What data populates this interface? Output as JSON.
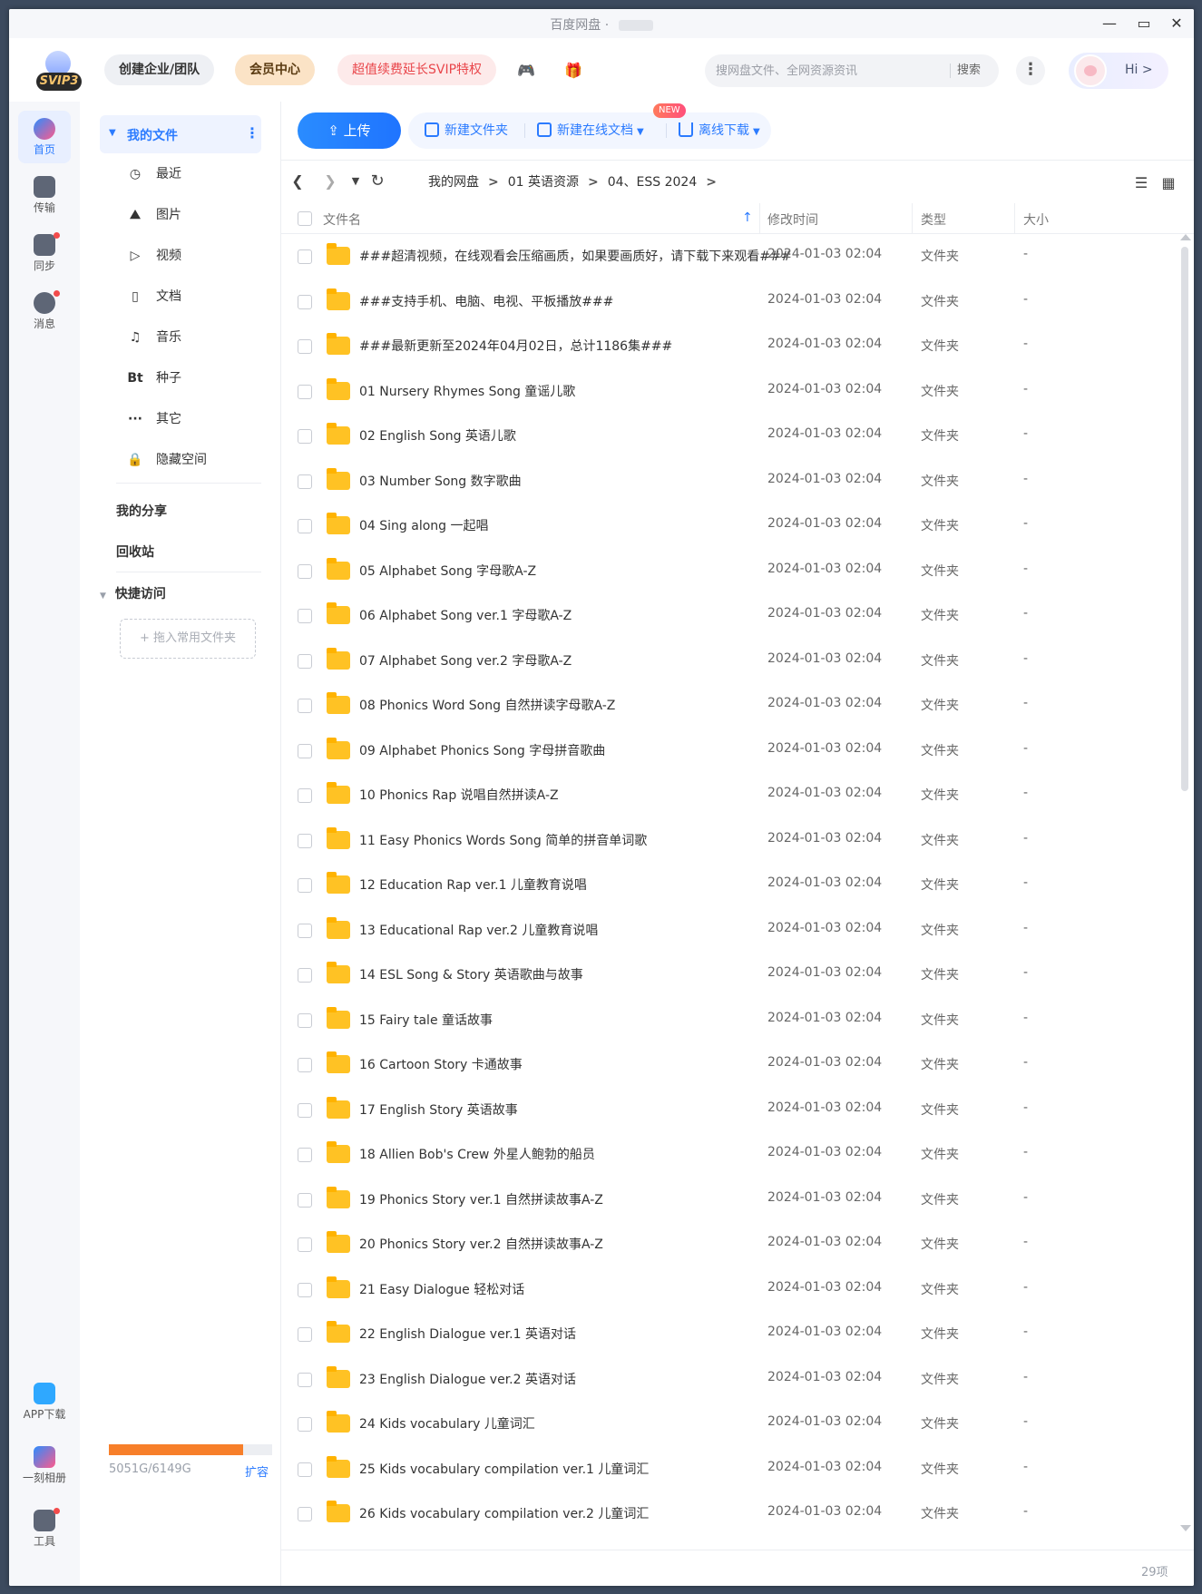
{
  "window": {
    "title": "百度网盘"
  },
  "header": {
    "logo_badge": "SVIP3",
    "team_label": "创建企业/团队",
    "vip_label": "会员中心",
    "promo_label": "超值续费延长SVIP特权",
    "search_placeholder": "搜网盘文件、全网资源资讯",
    "search_button": "搜索",
    "greeting": "Hi >"
  },
  "rail": {
    "items": [
      {
        "label": "首页"
      },
      {
        "label": "传输"
      },
      {
        "label": "同步"
      },
      {
        "label": "消息"
      },
      {
        "label": "APP下载"
      },
      {
        "label": "一刻相册"
      },
      {
        "label": "工具"
      }
    ]
  },
  "sidebar": {
    "my_files": "我的文件",
    "items": [
      {
        "icon": "◷",
        "label": "最近"
      },
      {
        "icon": "⛰",
        "label": "图片"
      },
      {
        "icon": "▷",
        "label": "视频"
      },
      {
        "icon": "▯",
        "label": "文档"
      },
      {
        "icon": "♫",
        "label": "音乐"
      },
      {
        "icon": "Bt",
        "label": "种子"
      },
      {
        "icon": "···",
        "label": "其它"
      },
      {
        "icon": "🔒",
        "label": "隐藏空间"
      }
    ],
    "my_share": "我的分享",
    "recycle": "回收站",
    "quick_access": "快捷访问",
    "drop_hint": "+ 拖入常用文件夹",
    "quota": "5051G/6149G",
    "quota_used_fraction": 0.821,
    "expand": "扩容"
  },
  "toolbar": {
    "upload": "上传",
    "new_folder": "新建文件夹",
    "new_doc": "新建在线文档",
    "new_badge": "NEW",
    "offline": "离线下载"
  },
  "breadcrumb": [
    "我的网盘",
    "01 英语资源",
    "04、ESS 2024"
  ],
  "table": {
    "headers": {
      "name": "文件名",
      "mtime": "修改时间",
      "type": "类型",
      "size": "大小"
    },
    "rows": [
      {
        "name": "###超清视频，在线观看会压缩画质，如果要画质好，请下载下来观看###",
        "mtime": "2024-01-03 02:04",
        "type": "文件夹",
        "size": "-"
      },
      {
        "name": "###支持手机、电脑、电视、平板播放###",
        "mtime": "2024-01-03 02:04",
        "type": "文件夹",
        "size": "-"
      },
      {
        "name": "###最新更新至2024年04月02日，总计1186集###",
        "mtime": "2024-01-03 02:04",
        "type": "文件夹",
        "size": "-"
      },
      {
        "name": "01 Nursery Rhymes Song 童谣儿歌",
        "mtime": "2024-01-03 02:04",
        "type": "文件夹",
        "size": "-"
      },
      {
        "name": "02 English Song 英语儿歌",
        "mtime": "2024-01-03 02:04",
        "type": "文件夹",
        "size": "-"
      },
      {
        "name": "03 Number Song 数字歌曲",
        "mtime": "2024-01-03 02:04",
        "type": "文件夹",
        "size": "-"
      },
      {
        "name": "04 Sing along 一起唱",
        "mtime": "2024-01-03 02:04",
        "type": "文件夹",
        "size": "-"
      },
      {
        "name": "05 Alphabet Song 字母歌A-Z",
        "mtime": "2024-01-03 02:04",
        "type": "文件夹",
        "size": "-"
      },
      {
        "name": "06 Alphabet Song ver.1 字母歌A-Z",
        "mtime": "2024-01-03 02:04",
        "type": "文件夹",
        "size": "-"
      },
      {
        "name": "07 Alphabet Song ver.2 字母歌A-Z",
        "mtime": "2024-01-03 02:04",
        "type": "文件夹",
        "size": "-"
      },
      {
        "name": "08 Phonics Word Song 自然拼读字母歌A-Z",
        "mtime": "2024-01-03 02:04",
        "type": "文件夹",
        "size": "-"
      },
      {
        "name": "09 Alphabet Phonics Song 字母拼音歌曲",
        "mtime": "2024-01-03 02:04",
        "type": "文件夹",
        "size": "-"
      },
      {
        "name": "10 Phonics Rap 说唱自然拼读A-Z",
        "mtime": "2024-01-03 02:04",
        "type": "文件夹",
        "size": "-"
      },
      {
        "name": "11 Easy Phonics Words Song 简单的拼音单词歌",
        "mtime": "2024-01-03 02:04",
        "type": "文件夹",
        "size": "-"
      },
      {
        "name": "12 Education Rap ver.1 儿童教育说唱",
        "mtime": "2024-01-03 02:04",
        "type": "文件夹",
        "size": "-"
      },
      {
        "name": "13 Educational Rap ver.2 儿童教育说唱",
        "mtime": "2024-01-03 02:04",
        "type": "文件夹",
        "size": "-"
      },
      {
        "name": "14 ESL Song & Story 英语歌曲与故事",
        "mtime": "2024-01-03 02:04",
        "type": "文件夹",
        "size": "-"
      },
      {
        "name": "15 Fairy tale 童话故事",
        "mtime": "2024-01-03 02:04",
        "type": "文件夹",
        "size": "-"
      },
      {
        "name": "16 Cartoon Story 卡通故事",
        "mtime": "2024-01-03 02:04",
        "type": "文件夹",
        "size": "-"
      },
      {
        "name": "17 English Story 英语故事",
        "mtime": "2024-01-03 02:04",
        "type": "文件夹",
        "size": "-"
      },
      {
        "name": "18 Allien Bob's Crew 外星人鲍勃的船员",
        "mtime": "2024-01-03 02:04",
        "type": "文件夹",
        "size": "-"
      },
      {
        "name": "19 Phonics Story ver.1 自然拼读故事A-Z",
        "mtime": "2024-01-03 02:04",
        "type": "文件夹",
        "size": "-"
      },
      {
        "name": "20 Phonics Story ver.2 自然拼读故事A-Z",
        "mtime": "2024-01-03 02:04",
        "type": "文件夹",
        "size": "-"
      },
      {
        "name": "21 Easy Dialogue 轻松对话",
        "mtime": "2024-01-03 02:04",
        "type": "文件夹",
        "size": "-"
      },
      {
        "name": "22 English Dialogue ver.1 英语对话",
        "mtime": "2024-01-03 02:04",
        "type": "文件夹",
        "size": "-"
      },
      {
        "name": "23 English Dialogue ver.2 英语对话",
        "mtime": "2024-01-03 02:04",
        "type": "文件夹",
        "size": "-"
      },
      {
        "name": "24 Kids vocabulary 儿童词汇",
        "mtime": "2024-01-03 02:04",
        "type": "文件夹",
        "size": "-"
      },
      {
        "name": "25 Kids vocabulary compilation ver.1 儿童词汇",
        "mtime": "2024-01-03 02:04",
        "type": "文件夹",
        "size": "-"
      },
      {
        "name": "26 Kids vocabulary compilation ver.2 儿童词汇",
        "mtime": "2024-01-03 02:04",
        "type": "文件夹",
        "size": "-"
      }
    ],
    "count": "29项"
  },
  "colors": {
    "accent": "#2b7bff",
    "folder": "#ffc224",
    "quota": "#f77f2a",
    "vip_bg": "#fbe3c6",
    "promo": "#e9464b"
  }
}
